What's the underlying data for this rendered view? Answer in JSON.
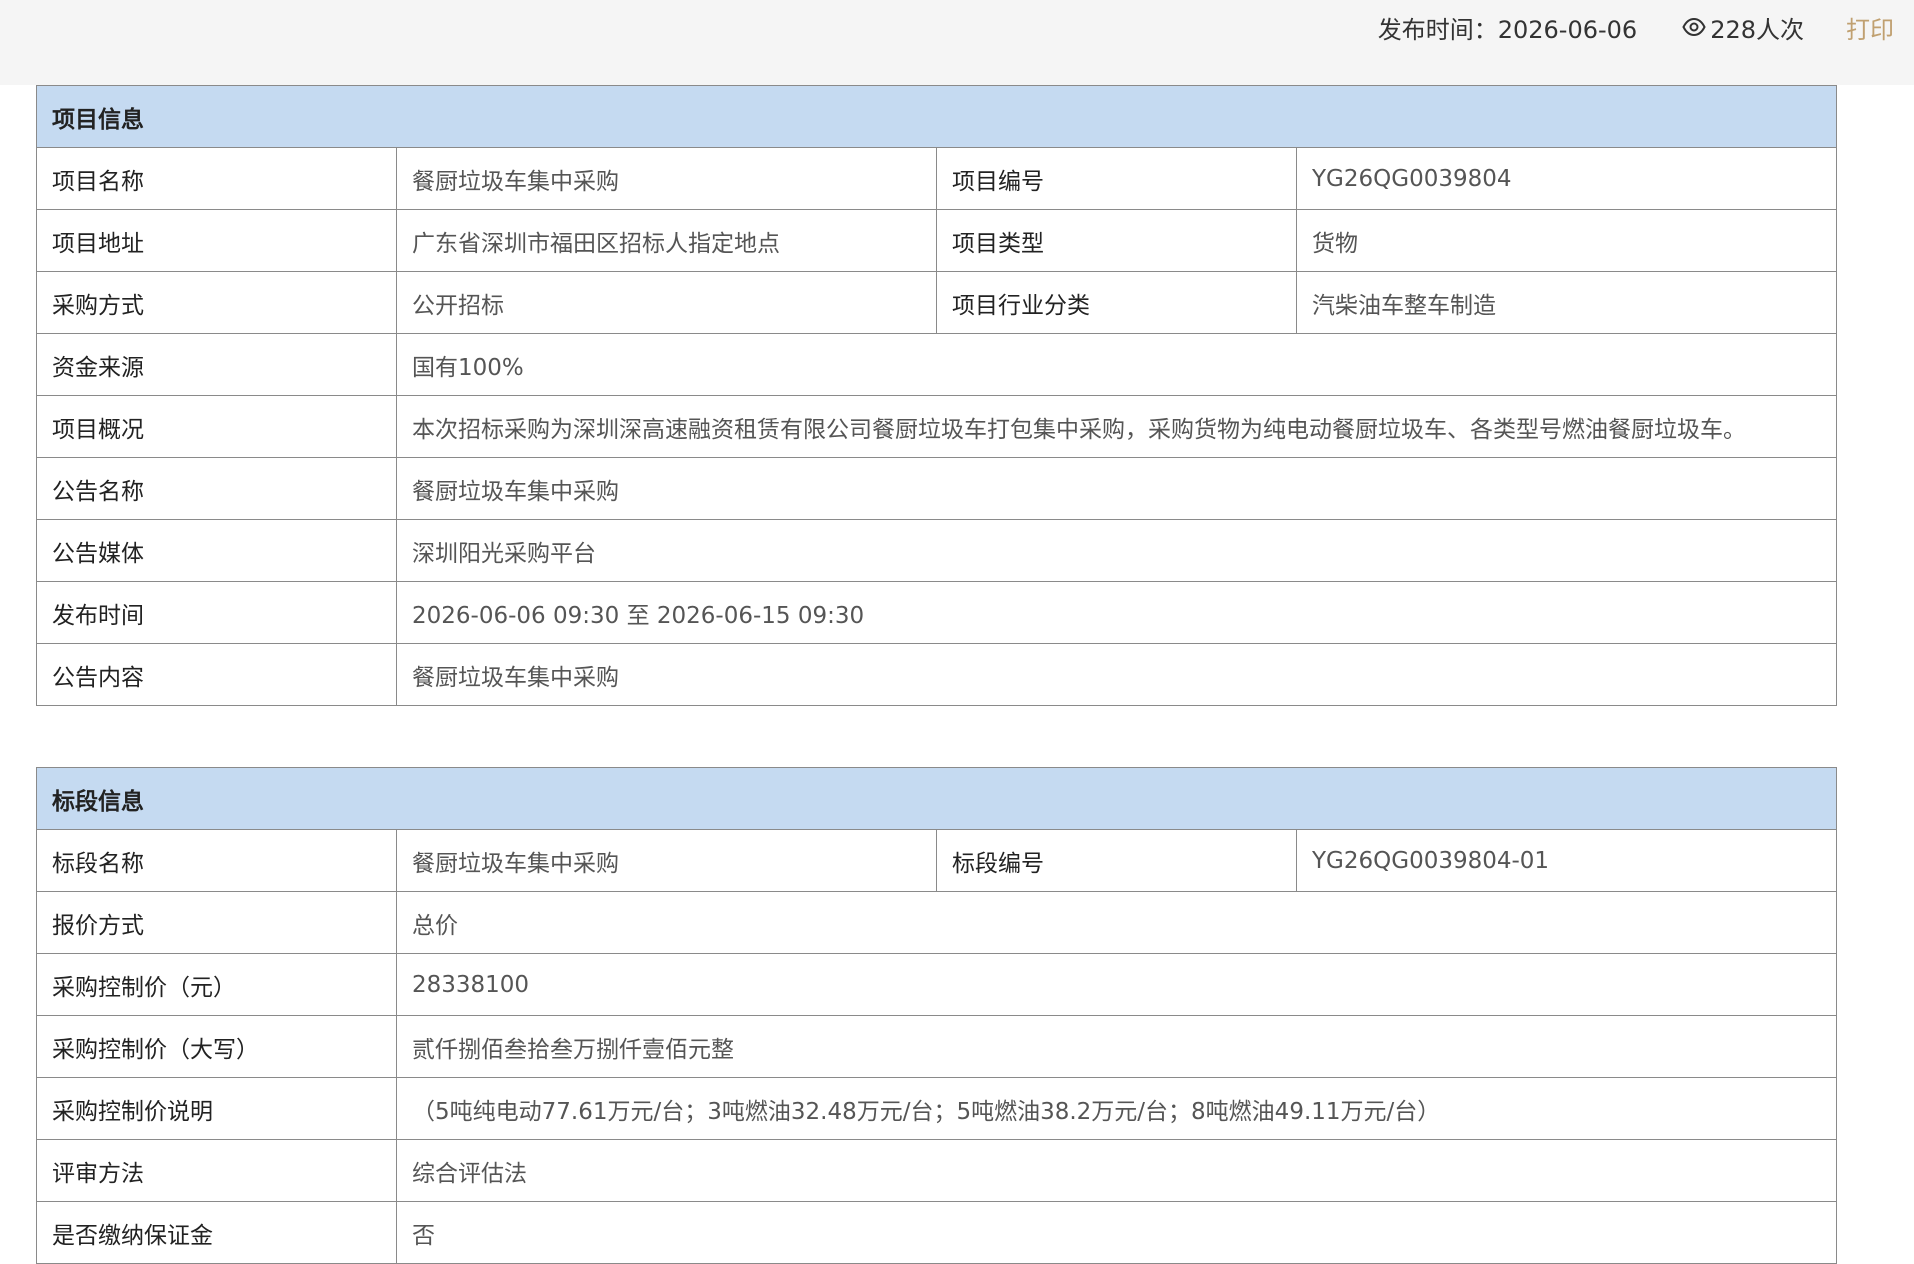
{
  "header": {
    "publish_time": "发布时间：2026-06-06",
    "views": "228人次",
    "print_label": "打印",
    "view_icon": "eye-icon"
  },
  "project": {
    "title": "项目信息",
    "name_label": "项目名称",
    "name_value": "餐厨垃圾车集中采购",
    "code_label": "项目编号",
    "code_value": "YG26QG0039804",
    "address_label": "项目地址",
    "address_value": "广东省深圳市福田区招标人指定地点",
    "type_label": "项目类型",
    "type_value": "货物",
    "method_label": "采购方式",
    "method_value": "公开招标",
    "industry_label": "项目行业分类",
    "industry_value": "汽柴油车整车制造",
    "fund_label": "资金来源",
    "fund_value": "国有100%",
    "overview_label": "项目概况",
    "overview_value": "本次招标采购为深圳深高速融资租赁有限公司餐厨垃圾车打包集中采购，采购货物为纯电动餐厨垃圾车、各类型号燃油餐厨垃圾车。",
    "notice_name_label": "公告名称",
    "notice_name_value": "餐厨垃圾车集中采购",
    "media_label": "公告媒体",
    "media_value": "深圳阳光采购平台",
    "time_label": "发布时间",
    "time_value": "2026-06-06 09:30 至 2026-06-15 09:30",
    "content_label": "公告内容",
    "content_value": "餐厨垃圾车集中采购"
  },
  "section": {
    "title": "标段信息",
    "name_label": "标段名称",
    "name_value": "餐厨垃圾车集中采购",
    "code_label": "标段编号",
    "code_value": "YG26QG0039804-01",
    "quote_label": "报价方式",
    "quote_value": "总价",
    "price_label": "采购控制价（元）",
    "price_value": "28338100",
    "price_cn_label": "采购控制价（大写）",
    "price_cn_value": "贰仟捌佰叁拾叁万捌仟壹佰元整",
    "price_note_label": "采购控制价说明",
    "price_note_value": "（5吨纯电动77.61万元/台；3吨燃油32.48万元/台；5吨燃油38.2万元/台；8吨燃油49.11万元/台）",
    "review_label": "评审方法",
    "review_value": "综合评估法",
    "deposit_label": "是否缴纳保证金",
    "deposit_value": "否"
  }
}
